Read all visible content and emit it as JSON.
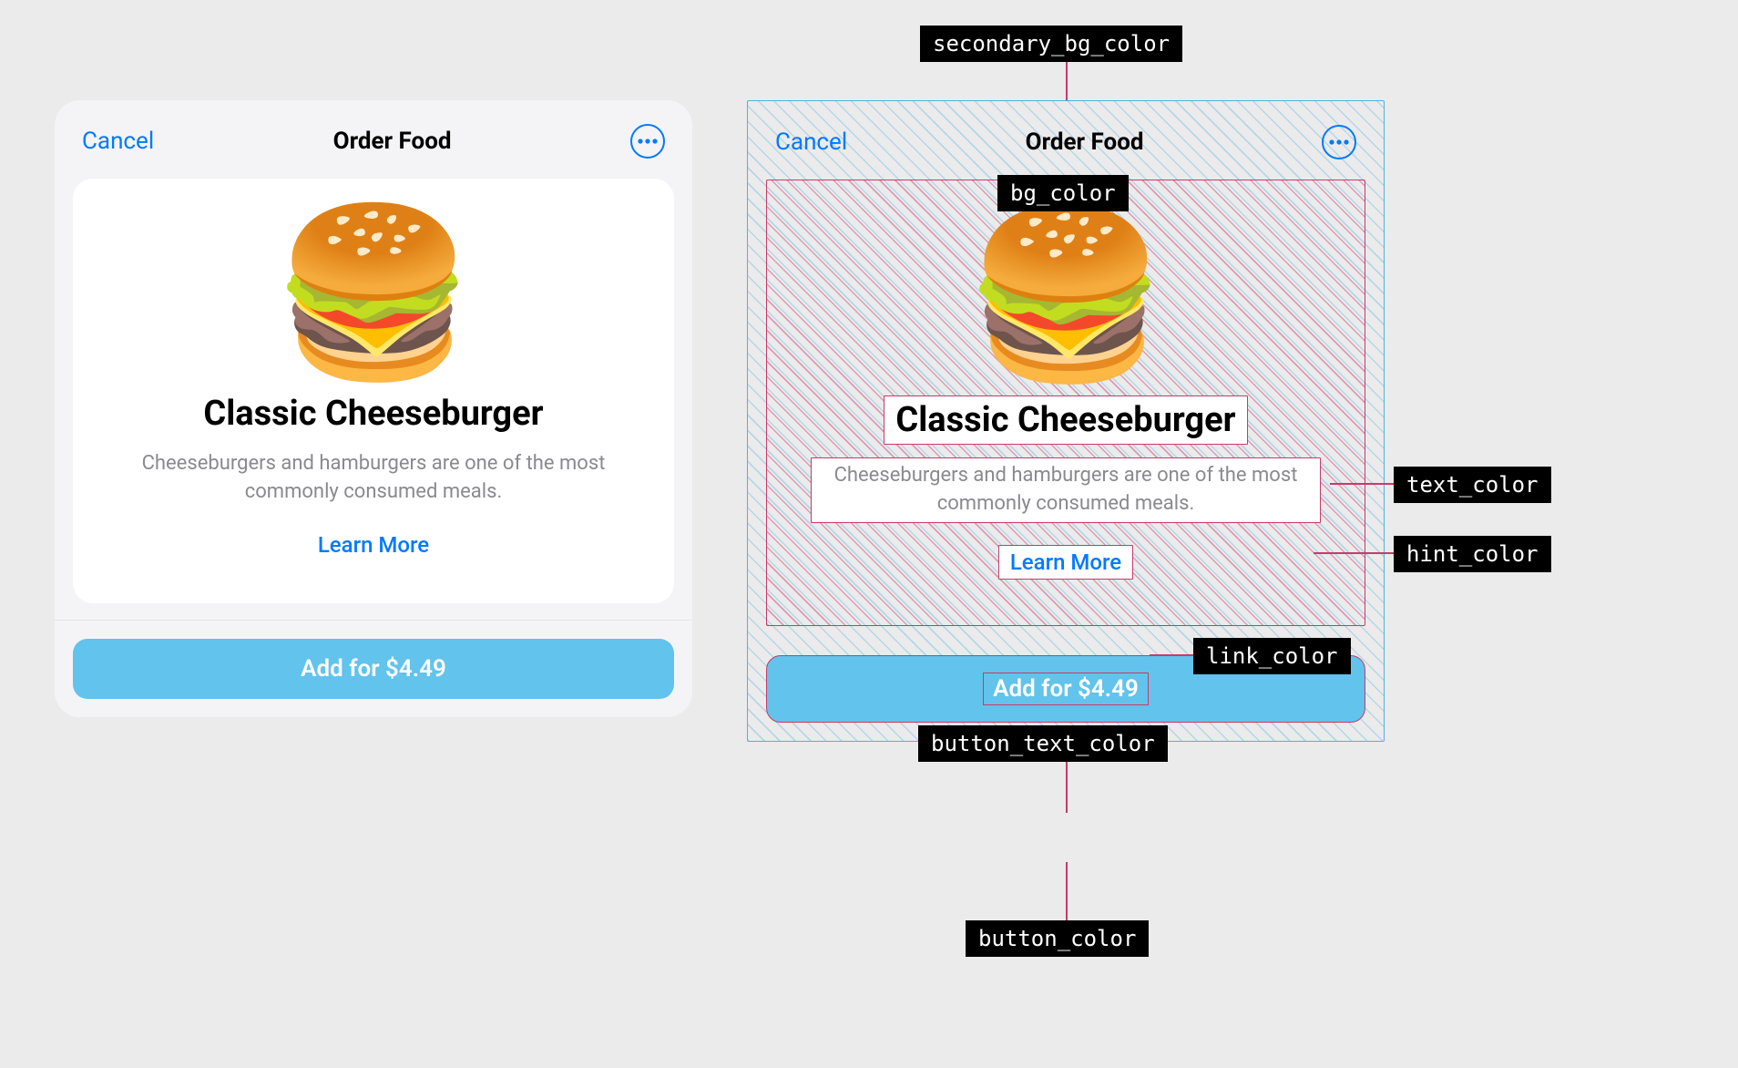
{
  "app": {
    "header": {
      "cancel": "Cancel",
      "title": "Order Food",
      "more_icon": "ellipsis"
    },
    "product": {
      "emoji": "🍔",
      "name": "Classic Cheeseburger",
      "description": "Cheeseburgers and hamburgers are one of the most commonly consumed meals.",
      "learn_more": "Learn More"
    },
    "cta": {
      "label": "Add for $4.49"
    }
  },
  "annotations": {
    "secondary_bg_color": "secondary_bg_color",
    "bg_color": "bg_color",
    "text_color": "text_color",
    "hint_color": "hint_color",
    "link_color": "link_color",
    "button_text_color": "button_text_color",
    "button_color": "button_color"
  },
  "theme": {
    "secondary_bg_color": "#f4f4f6",
    "bg_color": "#ffffff",
    "text_color": "#000000",
    "hint_color": "#8a8a8e",
    "link_color": "#007aff",
    "button_color": "#62c3ec",
    "button_text_color": "#ffffff"
  }
}
